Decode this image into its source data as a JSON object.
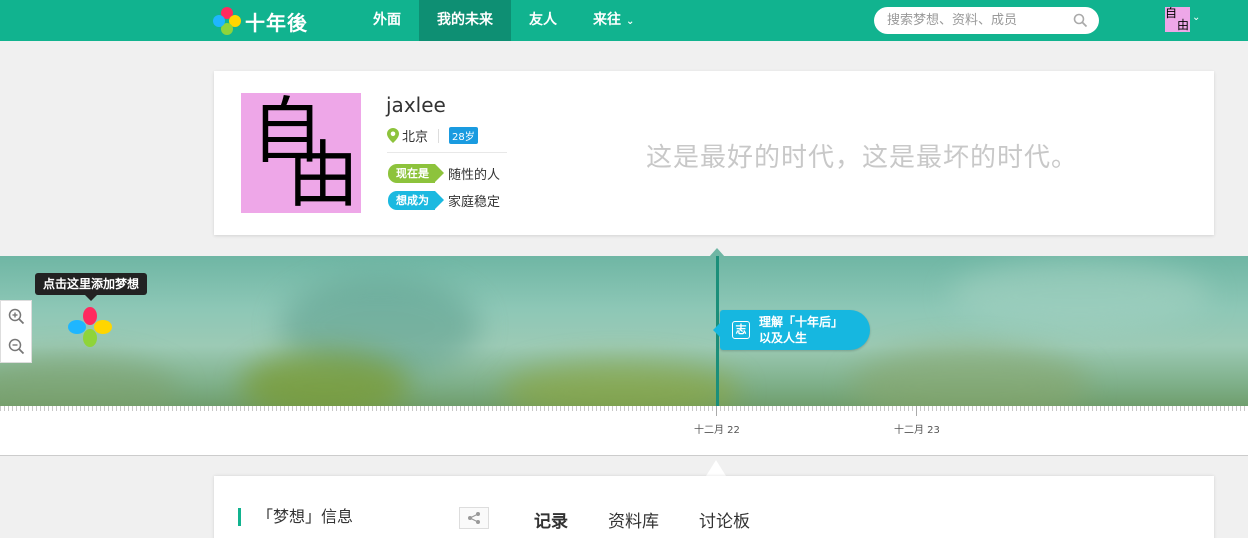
{
  "app": {
    "brand": "十年後",
    "nav": [
      {
        "label": "外面"
      },
      {
        "label": "我的未来"
      },
      {
        "label": "友人"
      },
      {
        "label": "来往"
      }
    ],
    "search_placeholder": "搜索梦想、资料、成员",
    "user_avatar_chars": [
      "自",
      "由"
    ]
  },
  "profile": {
    "avatar_chars": [
      "自",
      "由"
    ],
    "username": "jaxlee",
    "location": "北京",
    "age": "28岁",
    "now_label": "现在是",
    "now_value": "随性的人",
    "want_label": "想成为",
    "want_value": "家庭稳定",
    "motto": "这是最好的时代，这是最坏的时代。"
  },
  "timeline": {
    "tooltip": "点击这里添加梦想",
    "event_icon": "志",
    "event_line1": "理解「十年后」",
    "event_line2": "以及人生",
    "tick_labels": [
      "十二月 22",
      "十二月 23"
    ]
  },
  "dream": {
    "title": "「梦想」信息",
    "tabs": [
      {
        "label": "记录"
      },
      {
        "label": "资料库"
      },
      {
        "label": "讨论板"
      }
    ]
  },
  "colors": {
    "brand_green": "#11b38f",
    "nav_active": "#0e8f73",
    "tag_now": "#8dc33c",
    "tag_want": "#1bb9e0",
    "avatar_bg": "#eea7e8"
  },
  "icons": [
    "logo-flower-icon",
    "search-icon",
    "chevron-down-icon",
    "location-pin-icon",
    "zoom-in-icon",
    "zoom-out-icon",
    "flower-add-icon",
    "share-icon"
  ]
}
